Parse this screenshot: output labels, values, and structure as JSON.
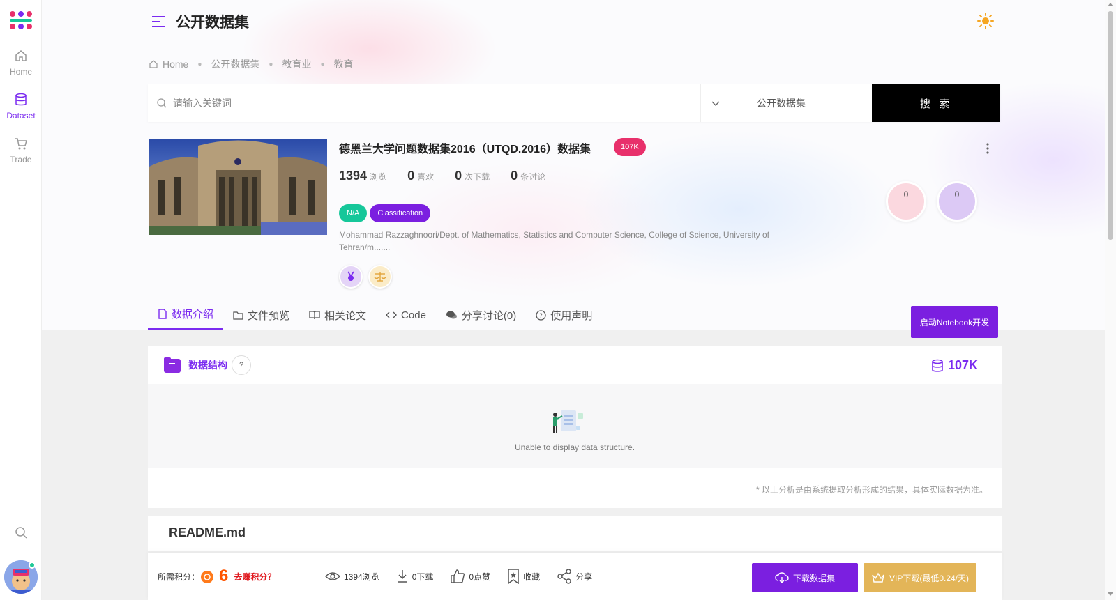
{
  "sidebar": {
    "items": [
      {
        "label": "Home",
        "icon": "home-icon"
      },
      {
        "label": "Dataset",
        "icon": "database-icon"
      },
      {
        "label": "Trade",
        "icon": "cart-icon"
      }
    ]
  },
  "header": {
    "title": "公开数据集"
  },
  "breadcrumb": [
    "Home",
    "公开数据集",
    "教育业",
    "教育"
  ],
  "search": {
    "placeholder": "请输入关键词",
    "scope": "公开数据集",
    "button": "搜 索"
  },
  "dataset": {
    "title": "德黑兰大学问题数据集2016（UTQD.2016）数据集",
    "size_badge": "107K",
    "stats": [
      {
        "value": "1394",
        "label": "浏览"
      },
      {
        "value": "0",
        "label": "喜欢"
      },
      {
        "value": "0",
        "label": "次下载"
      },
      {
        "value": "0",
        "label": "条讨论"
      }
    ],
    "tags": [
      "N/A",
      "Classification"
    ],
    "author": "Mohammad Razzaghnoori/Dept. of Mathematics, Statistics and Computer Science, College of Science, University of Tehran/m.......",
    "counters": [
      "0",
      "0"
    ]
  },
  "tabs": [
    {
      "label": "数据介绍",
      "icon": "file-icon"
    },
    {
      "label": "文件预览",
      "icon": "folder-icon"
    },
    {
      "label": "相关论文",
      "icon": "book-icon"
    },
    {
      "label": "Code",
      "icon": "code-icon"
    },
    {
      "label": "分享讨论(0)",
      "icon": "chat-icon"
    },
    {
      "label": "使用声明",
      "icon": "question-icon"
    }
  ],
  "notebook_button": "启动Notebook开发",
  "structure": {
    "title": "数据结构",
    "help": "?",
    "size": "107K",
    "empty_text": "Unable to display data structure.",
    "note": "* 以上分析是由系统提取分析形成的结果，具体实际数据为准。"
  },
  "readme": {
    "title": "README.md"
  },
  "bottom": {
    "points_label": "所需积分：",
    "points_value": "6",
    "earn_link": "去赚积分？",
    "views": "1394浏览",
    "downloads": "0下载",
    "likes": "0点赞",
    "favorite": "收藏",
    "share": "分享",
    "download_button": "下载数据集",
    "vip_button": "VIP下载(最低0.24/天)"
  },
  "colors": {
    "accent": "#7b2bf0",
    "badge_pink": "#e8306b",
    "tag_teal": "#16c79a",
    "vip_gold": "#e3b558"
  }
}
